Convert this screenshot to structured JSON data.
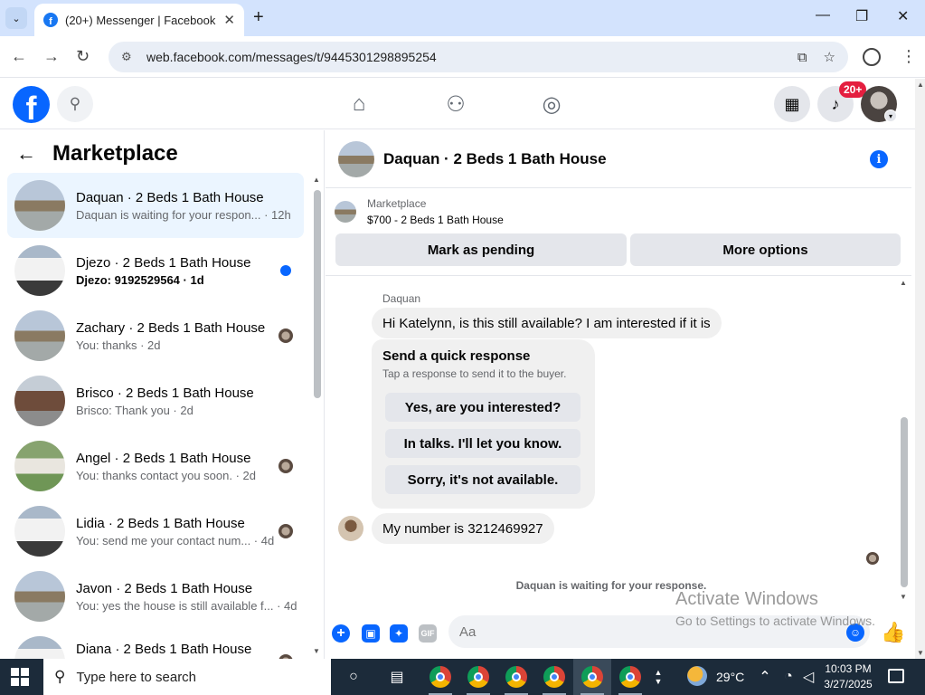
{
  "browser": {
    "tab_title": "(20+) Messenger | Facebook",
    "tab_close": "✕",
    "new_tab": "+",
    "tab_dropdown": "⌄",
    "url": "web.facebook.com/messages/t/9445301298895254",
    "win_min": "—",
    "win_max": "❐",
    "win_close": "✕",
    "back": "←",
    "forward": "→",
    "reload": "↻"
  },
  "fb_header": {
    "logo": "f",
    "notification_count": "20+"
  },
  "marketplace": {
    "back": "←",
    "title": "Marketplace",
    "conversations": [
      {
        "name": "Daquan · 2 Beds 1 Bath House",
        "preview": "Daquan is waiting for your respon... · 12h",
        "active": true,
        "unread": false,
        "indicator": "none"
      },
      {
        "name": "Djezo · 2 Beds 1 Bath House",
        "preview": "Djezo: 9192529564 · 1d",
        "active": false,
        "unread": true,
        "indicator": "dot"
      },
      {
        "name": "Zachary · 2 Beds 1 Bath House",
        "preview": "You: thanks · 2d",
        "active": false,
        "unread": false,
        "indicator": "avatar"
      },
      {
        "name": "Brisco · 2 Beds 1 Bath House",
        "preview": "Brisco: Thank you · 2d",
        "active": false,
        "unread": false,
        "indicator": "none"
      },
      {
        "name": "Angel · 2 Beds 1 Bath House",
        "preview": "You: thanks contact you soon. · 2d",
        "active": false,
        "unread": false,
        "indicator": "avatar"
      },
      {
        "name": "Lidia · 2 Beds 1 Bath House",
        "preview": "You: send me your contact num... · 4d",
        "active": false,
        "unread": false,
        "indicator": "avatar"
      },
      {
        "name": "Javon · 2 Beds 1 Bath House",
        "preview": "You: yes the house is still available f... · 4d",
        "active": false,
        "unread": false,
        "indicator": "none"
      },
      {
        "name": "Diana · 2 Beds 1 Bath House",
        "preview": "",
        "active": false,
        "unread": false,
        "indicator": "avatar"
      }
    ]
  },
  "chat": {
    "header_name": "Daquan · 2 Beds 1 Bath House",
    "info_icon": "i",
    "listing_category": "Marketplace",
    "listing_price_title": "$700 - 2 Beds 1 Bath House",
    "mark_pending": "Mark as pending",
    "more_options": "More options",
    "sender_name": "Daquan",
    "message_1": "Hi Katelynn, is this still available? I am interested if it is",
    "quick_response_title": "Send a quick response",
    "quick_response_sub": "Tap a response to send it to the buyer.",
    "quick_responses": [
      "Yes, are you interested?",
      "In talks. I'll let you know.",
      "Sorry, it's not available."
    ],
    "message_2": "My number is 3212469927",
    "waiting_note": "Daquan is waiting for your response.",
    "input_placeholder": "Aa",
    "icon_plus": "+",
    "icon_gif": "GIF"
  },
  "watermark": {
    "line1": "Activate Windows",
    "line2": "Go to Settings to activate Windows."
  },
  "taskbar": {
    "search_placeholder": "Type here to search",
    "temperature": "29°C",
    "time": "10:03 PM",
    "date": "3/27/2025"
  },
  "colors": {
    "facebook_blue": "#0866ff",
    "notification_red": "#e41e3f",
    "active_row": "#ebf5ff",
    "taskbar": "#1c2b3a"
  }
}
